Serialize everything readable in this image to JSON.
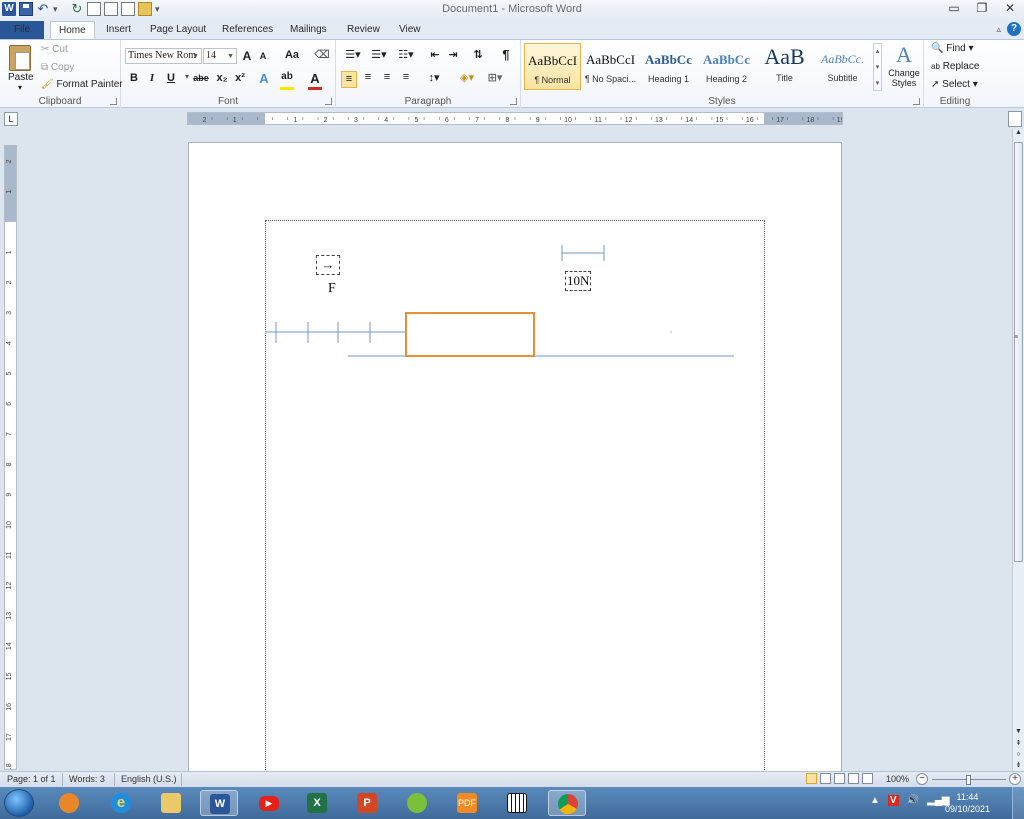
{
  "window": {
    "title": "Document1 - Microsoft Word",
    "controls": [
      "minimize-icon",
      "restore-icon",
      "close-icon"
    ]
  },
  "quick_access": [
    "word-logo-icon",
    "save-icon",
    "undo-icon",
    "redo-icon",
    "new-icon",
    "print-preview-icon",
    "open-icon",
    "customize-icon"
  ],
  "tabs": [
    {
      "id": "file",
      "label": "File"
    },
    {
      "id": "home",
      "label": "Home"
    },
    {
      "id": "insert",
      "label": "Insert"
    },
    {
      "id": "page-layout",
      "label": "Page Layout"
    },
    {
      "id": "references",
      "label": "References"
    },
    {
      "id": "mailings",
      "label": "Mailings"
    },
    {
      "id": "review",
      "label": "Review"
    },
    {
      "id": "view",
      "label": "View"
    }
  ],
  "ribbon": {
    "clipboard": {
      "label": "Clipboard",
      "paste": "Paste",
      "cut": "Cut",
      "copy": "Copy",
      "format_painter": "Format Painter"
    },
    "font": {
      "label": "Font",
      "font_name": "Times New Rom",
      "font_size": "14",
      "grow": "A",
      "shrink": "A",
      "change_case": "Aa",
      "bold": "B",
      "italic": "I",
      "underline": "U",
      "strike": "abe",
      "subscript": "x₂",
      "superscript": "x²",
      "highlight_color": "#f7e600",
      "font_color": "#d62b1f"
    },
    "paragraph": {
      "label": "Paragraph",
      "pilcrow": "¶"
    },
    "styles": {
      "label": "Styles",
      "items": [
        {
          "sample": "AaBbCcI",
          "name": "¶ Normal",
          "color": "#111111"
        },
        {
          "sample": "AaBbCcI",
          "name": "¶ No Spaci...",
          "color": "#111111"
        },
        {
          "sample": "AaBbCc",
          "name": "Heading 1",
          "color": "#2e5c9a"
        },
        {
          "sample": "AaBbCc",
          "name": "Heading 2",
          "color": "#4f81bd"
        },
        {
          "sample": "AaB",
          "name": "Title",
          "color": "#17365d"
        },
        {
          "sample": "AaBbCc.",
          "name": "Subtitle",
          "color": "#4f81bd"
        }
      ],
      "change_styles": "Change Styles"
    },
    "editing": {
      "label": "Editing",
      "find": "Find",
      "replace": "Replace",
      "select": "Select"
    }
  },
  "ruler": {
    "h_labels": [
      "2",
      "1",
      "1",
      "2",
      "3",
      "4",
      "5",
      "6",
      "7",
      "8",
      "9",
      "10",
      "11",
      "12",
      "13",
      "14",
      "15",
      "16",
      "17",
      "18",
      "19"
    ],
    "v_labels": [
      "2",
      "1",
      "1",
      "2",
      "3",
      "4",
      "5",
      "6",
      "7",
      "8",
      "9",
      "10",
      "11",
      "12",
      "13",
      "14",
      "15",
      "16",
      "17",
      "18"
    ]
  },
  "document": {
    "arrow_symbol": "→",
    "force_label": "F",
    "scale_label": "10N",
    "line_color": "#6f9ac7",
    "box_color": "#e3913a"
  },
  "statusbar": {
    "page": "Page: 1 of 1",
    "words": "Words: 3",
    "language": "English (U.S.)",
    "zoom": "100%",
    "zoom_level": 1.0
  },
  "taskbar": {
    "apps": [
      "media-player-icon",
      "internet-explorer-icon",
      "file-explorer-icon",
      "word-icon",
      "youtube-icon",
      "excel-icon",
      "powerpoint-icon",
      "refresh-app-icon",
      "pdf-icon",
      "piano-app-icon",
      "chrome-icon"
    ],
    "time": "11:44",
    "date": "09/10/2021"
  }
}
